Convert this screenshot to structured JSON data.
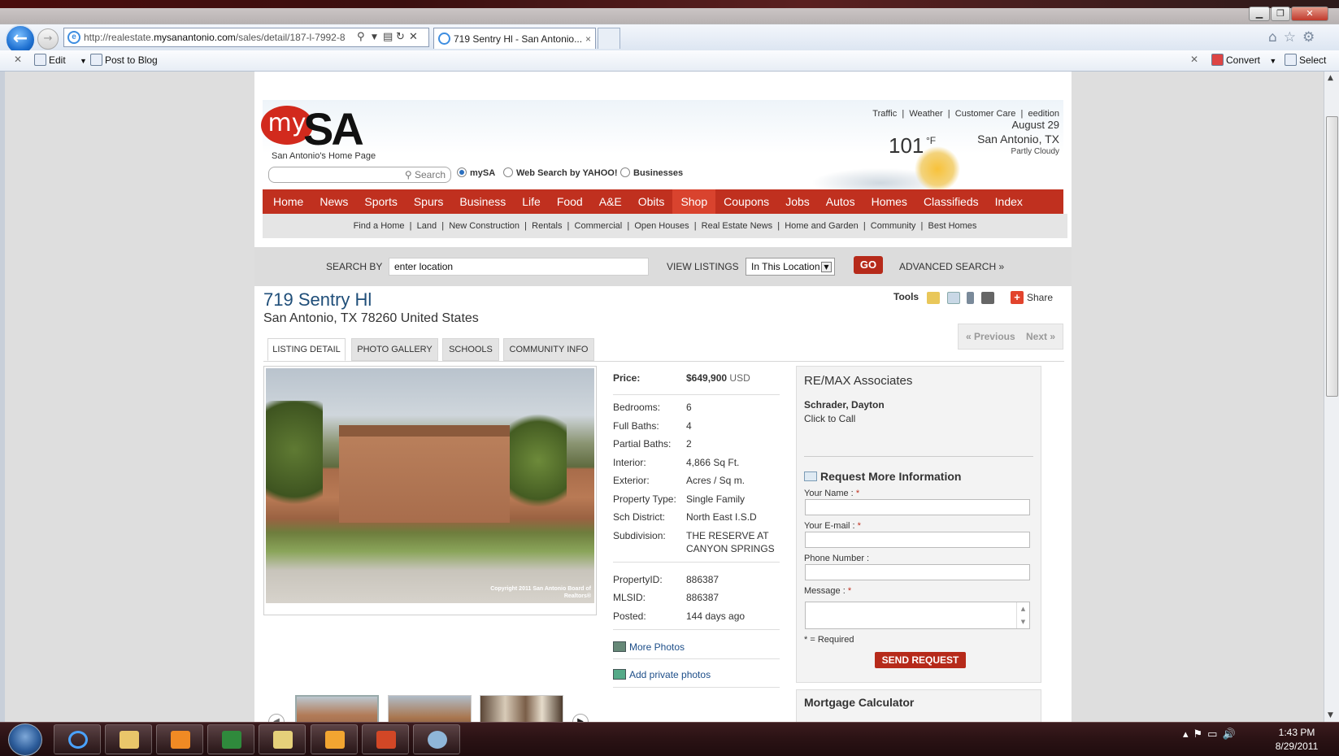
{
  "browser": {
    "url_prefix": "http://realestate.",
    "url_domain": "mysanantonio.com",
    "url_rest": "/sales/detail/187-l-7992-8",
    "tab_title": "719 Sentry Hl - San Antonio...",
    "tab_close": "×",
    "window_min": "▁",
    "window_max": "❐",
    "window_close": "✕",
    "cmd_close": "✕",
    "cmd_edit": "Edit",
    "cmd_post_to_blog": "Post to Blog",
    "cmd_convert": "Convert",
    "cmd_select": "Select",
    "right_icons": "⌂☆⚙"
  },
  "site": {
    "logo_my": "my",
    "logo_sa": "SA",
    "tagline": "San Antonio's Home Page",
    "search_label": "Search",
    "radios": [
      {
        "label": "mySA",
        "selected": true
      },
      {
        "label": "Web Search by YAHOO!",
        "selected": false
      },
      {
        "label": "Businesses",
        "selected": false
      }
    ],
    "top_links": [
      "Traffic",
      "Weather",
      "Customer Care",
      "eedition"
    ],
    "weather": {
      "date": "August 29",
      "temp": "101",
      "unit": "°F",
      "city": "San Antonio, TX",
      "condition": "Partly Cloudy"
    },
    "main_nav": [
      "Home",
      "News",
      "Sports",
      "Spurs",
      "Business",
      "Life",
      "Food",
      "A&E",
      "Obits",
      "Shop",
      "Coupons",
      "Jobs",
      "Autos",
      "Homes",
      "Classifieds",
      "Index"
    ],
    "main_nav_selected": "Shop",
    "sub_nav": [
      "Find a Home",
      "Land",
      "New Construction",
      "Rentals",
      "Commercial",
      "Open Houses",
      "Real Estate News",
      "Home and Garden",
      "Community",
      "Best Homes"
    ]
  },
  "search": {
    "search_by_label": "SEARCH BY",
    "location_value": "enter location",
    "view_listings_label": "VIEW LISTINGS",
    "view_select_value": "In This Location",
    "go_label": "GO",
    "advanced_label": "ADVANCED SEARCH »"
  },
  "listing": {
    "title": "719 Sentry Hl",
    "address": "San Antonio, TX 78260 United States",
    "tools_label": "Tools",
    "share_label": "Share",
    "prev_label": "« Previous",
    "next_label": "Next »",
    "tabs": [
      "LISTING DETAIL",
      "PHOTO GALLERY",
      "SCHOOLS",
      "COMMUNITY INFO"
    ],
    "photo_copyright": "Copyright 2011 San Antonio Board of Realtors®",
    "price_label": "Price:",
    "price_value": "$649,900",
    "price_currency": "USD",
    "details": [
      {
        "label": "Bedrooms:",
        "value": "6"
      },
      {
        "label": "Full Baths:",
        "value": "4"
      },
      {
        "label": "Partial Baths:",
        "value": "2"
      },
      {
        "label": "Interior:",
        "value": "4,866 Sq Ft."
      },
      {
        "label": "Exterior:",
        "value": "Acres / Sq m."
      },
      {
        "label": "Property Type:",
        "value": "Single Family"
      },
      {
        "label": "Sch District:",
        "value": "North East I.S.D"
      },
      {
        "label": "Subdivision:",
        "value": "THE RESERVE AT",
        "value2": "CANYON SPRINGS"
      }
    ],
    "ids": [
      {
        "label": "PropertyID:",
        "value": "886387"
      },
      {
        "label": "MLSID:",
        "value": "886387"
      },
      {
        "label": "Posted:",
        "value": "144 days ago"
      }
    ],
    "more_photos": "More Photos",
    "add_private_photos": "Add private photos"
  },
  "agent": {
    "agency": "RE/MAX Associates",
    "name": "Schrader, Dayton",
    "call": "Click to Call",
    "request_title": "Request More Information",
    "fields": [
      "Your Name :",
      "Your E-mail :",
      "Phone Number :",
      "Message :"
    ],
    "required_mark": "*",
    "required_note": "* = Required",
    "send_label": "SEND REQUEST",
    "mortgage_title": "Mortgage Calculator"
  },
  "taskbar": {
    "time": "1:43 PM",
    "date": "8/29/2011"
  },
  "colors": {
    "nav_red": "#c0301f",
    "button_red": "#b62a1a",
    "title_blue": "#1f4e79",
    "link_blue": "#1d4e89"
  }
}
